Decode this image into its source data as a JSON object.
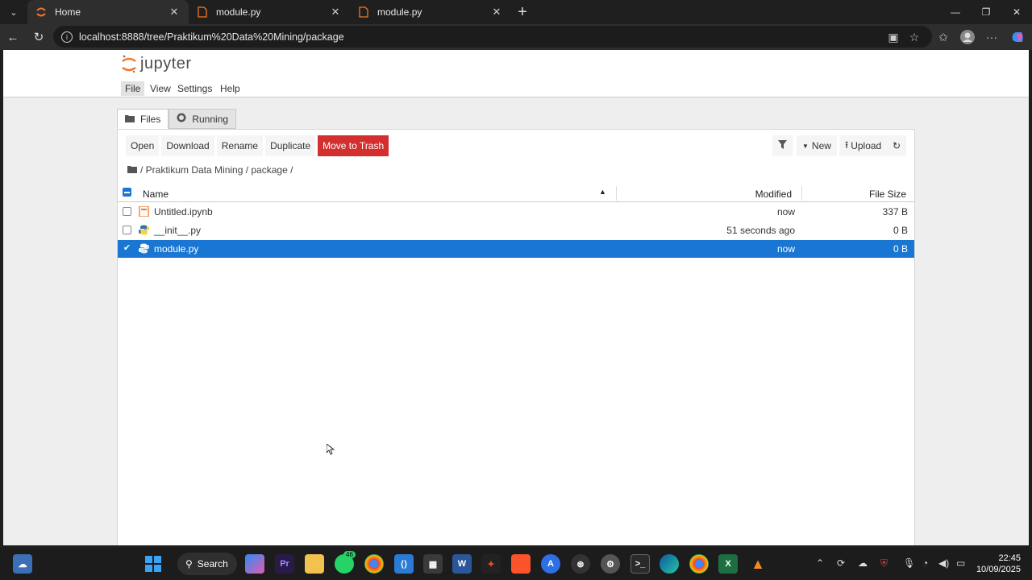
{
  "browser": {
    "tabs": [
      {
        "label": "Home",
        "active": true
      },
      {
        "label": "module.py",
        "active": false
      },
      {
        "label": "module.py",
        "active": false
      }
    ],
    "url": "localhost:8888/tree/Praktikum%20Data%20Mining/package"
  },
  "jupyter": {
    "logo_text": "jupyter",
    "menu": [
      "File",
      "View",
      "Settings",
      "Help"
    ],
    "tabs": [
      {
        "label": "Files",
        "icon": "folder-icon"
      },
      {
        "label": "Running",
        "icon": "running-icon"
      }
    ],
    "toolbar": {
      "open": "Open",
      "download": "Download",
      "rename": "Rename",
      "duplicate": "Duplicate",
      "trash": "Move to Trash",
      "new": "New",
      "upload": "Upload"
    },
    "breadcrumb": "/ Praktikum Data Mining / package /",
    "columns": {
      "name": "Name",
      "modified": "Modified",
      "size": "File Size"
    },
    "files": [
      {
        "name": "Untitled.ipynb",
        "modified": "now",
        "size": "337 B",
        "type": "notebook",
        "selected": false
      },
      {
        "name": "__init__.py",
        "modified": "51 seconds ago",
        "size": "0 B",
        "type": "python",
        "selected": false
      },
      {
        "name": "module.py",
        "modified": "now",
        "size": "0 B",
        "type": "python",
        "selected": true
      }
    ]
  },
  "taskbar": {
    "search_label": "Search",
    "badge_count": "46",
    "time": "22:45",
    "date": "10/09/2025"
  },
  "colors": {
    "selection": "#1976d2",
    "danger": "#d32f2f",
    "jupyter_orange": "#f37726"
  }
}
